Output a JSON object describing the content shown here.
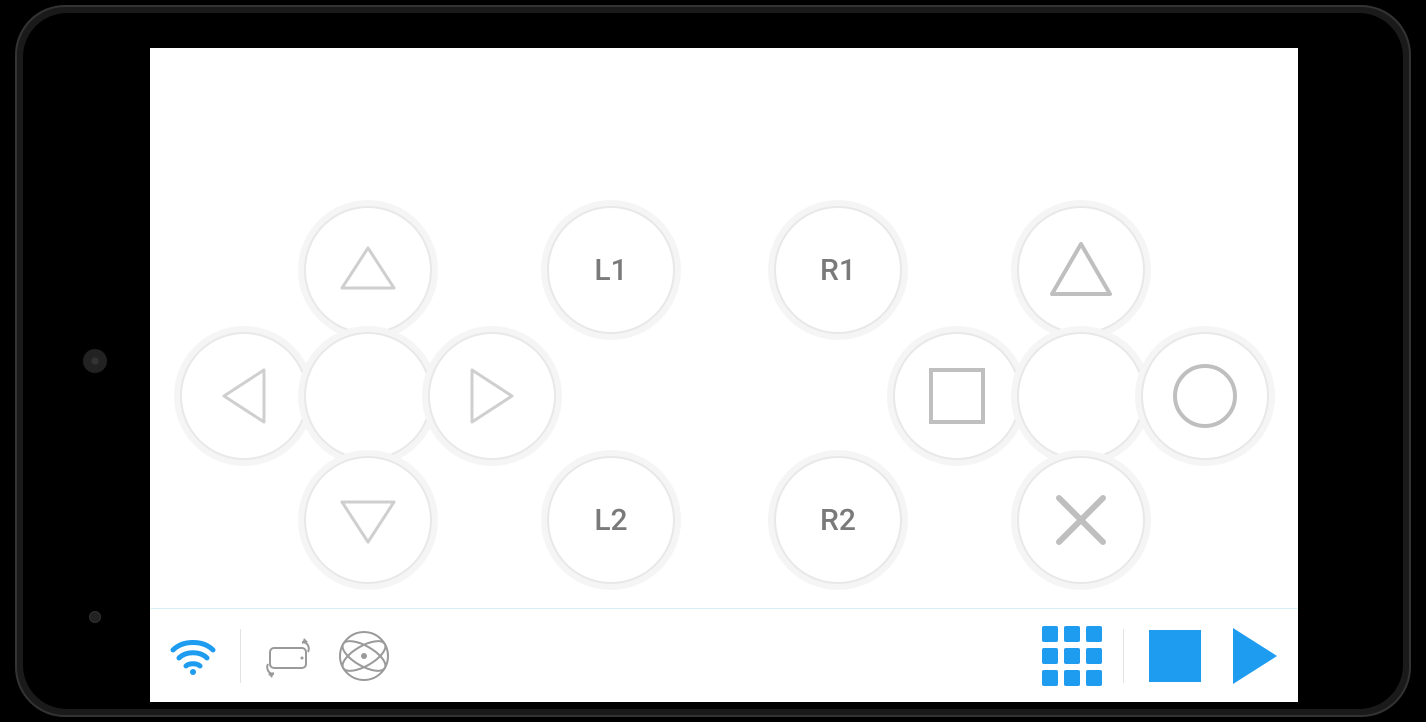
{
  "colors": {
    "accent": "#1e9cf0",
    "buttonRing": "#e8e8e8",
    "buttonOuter": "#f5f5f5",
    "label": "#7a7a7a",
    "icon": "#bfbfbf"
  },
  "controller": {
    "dpad": {
      "up": "up",
      "down": "down",
      "left": "left",
      "right": "right"
    },
    "shoulder": {
      "l1": "L1",
      "l2": "L2",
      "r1": "R1",
      "r2": "R2"
    },
    "face": {
      "triangle": "triangle",
      "square": "square",
      "circle": "circle",
      "cross": "cross"
    }
  },
  "toolbar": {
    "wifi": "wifi",
    "rotate": "rotate-device",
    "gyro": "atom-gyro",
    "grid": "grid",
    "stop": "stop",
    "play": "play"
  }
}
